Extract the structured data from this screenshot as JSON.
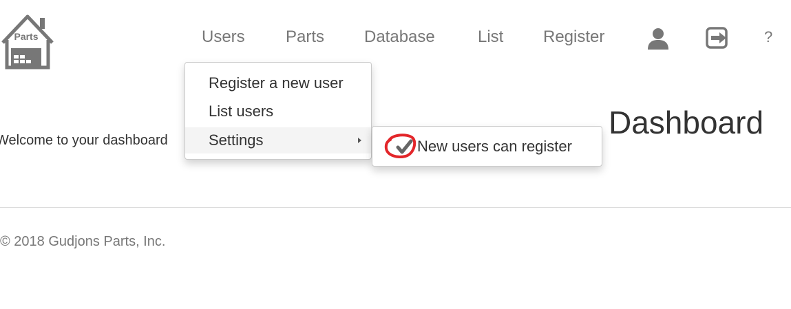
{
  "logo": {
    "text": "Parts"
  },
  "nav": {
    "users": "Users",
    "parts": "Parts",
    "database": "Database",
    "list": "List",
    "register": "Register",
    "help": "?"
  },
  "users_menu": {
    "items": [
      "Register a new user",
      "List users",
      "Settings"
    ]
  },
  "settings_submenu": {
    "items": [
      {
        "label": "New users can register",
        "checked": true
      }
    ]
  },
  "main": {
    "welcome": "Welcome to your dashboard",
    "title": "Dashboard"
  },
  "footer": {
    "copyright": "© 2018 Gudjons Parts, Inc."
  },
  "colors": {
    "nav_text": "#777777",
    "annotation": "#e3262a"
  }
}
